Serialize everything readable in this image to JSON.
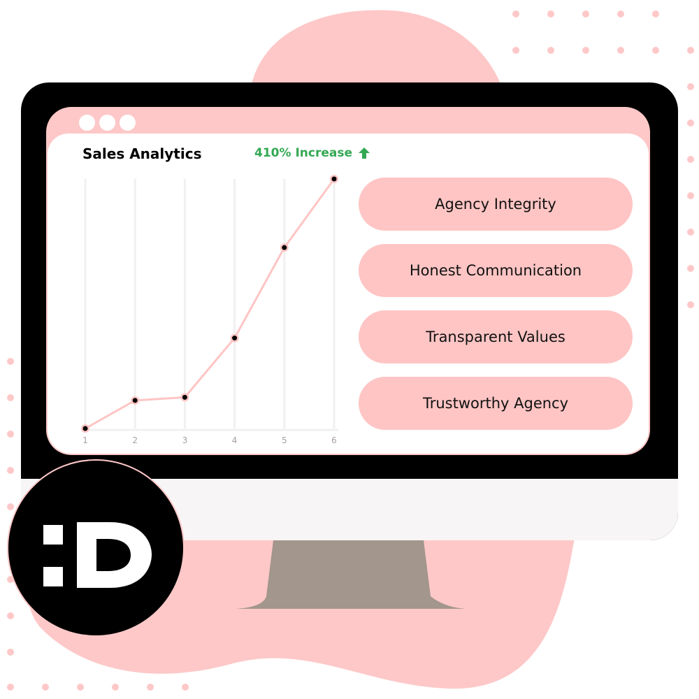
{
  "window": {
    "title": "Sales Analytics",
    "badge": "410% Increase",
    "badge_icon": "arrow-up-icon",
    "badge_color": "#34a853"
  },
  "pills": [
    {
      "label": "Agency Integrity"
    },
    {
      "label": "Honest Communication"
    },
    {
      "label": "Transparent Values"
    },
    {
      "label": "Trustworthy Agency"
    }
  ],
  "logo": {
    "text": ":D"
  },
  "colors": {
    "accent": "#fec8c8",
    "line": "#fec5c4",
    "stand": "#a3968c"
  },
  "chart_data": {
    "type": "line",
    "title": "Sales Analytics",
    "categories": [
      "1",
      "2",
      "3",
      "4",
      "5",
      "6"
    ],
    "x": [
      1,
      2,
      3,
      4,
      5,
      6
    ],
    "values": [
      0,
      9,
      10,
      29,
      58,
      80
    ],
    "ylim": [
      0,
      100
    ],
    "grid": "vertical",
    "xlabel": "",
    "ylabel": ""
  }
}
